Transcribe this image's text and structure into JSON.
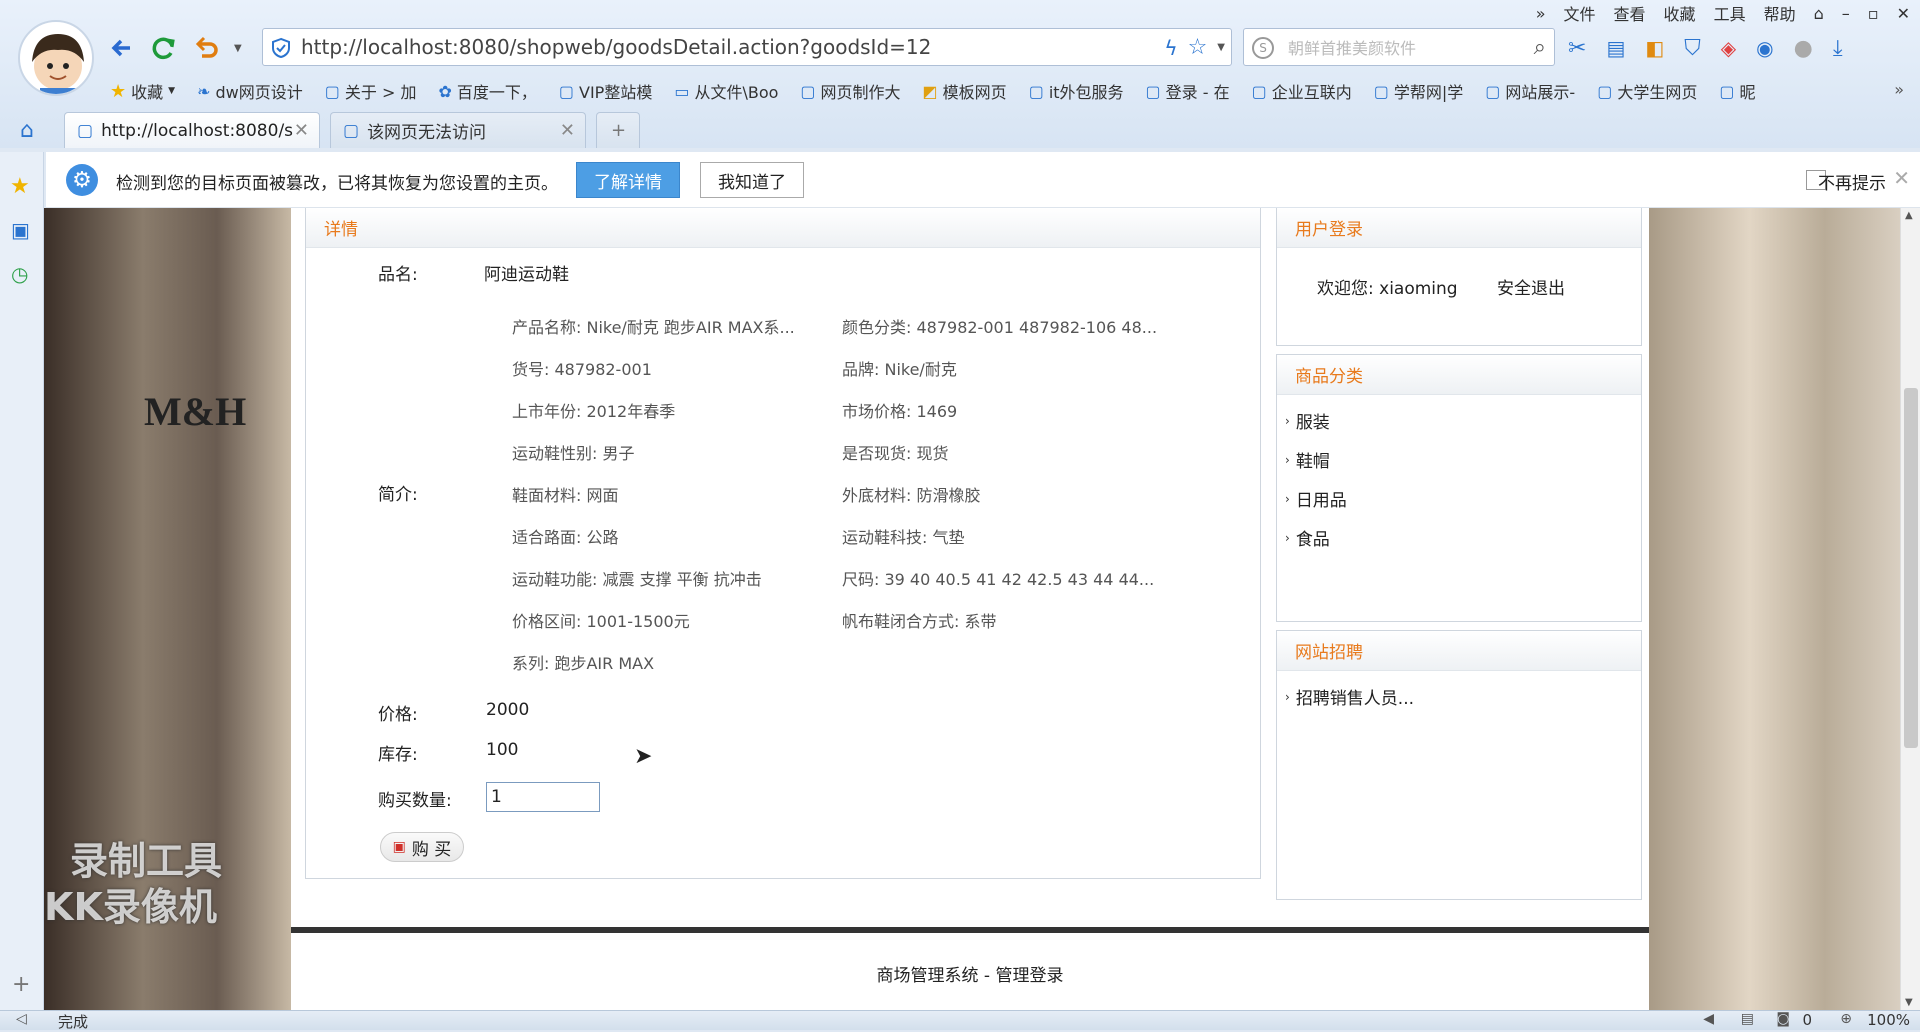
{
  "menubar": [
    "文件",
    "查看",
    "收藏",
    "工具",
    "帮助"
  ],
  "address": {
    "url": "http://localhost:8080/shopweb/goodsDetail.action?goodsId=12"
  },
  "search": {
    "placeholder": "朝鲜首推美颜软件"
  },
  "favorites": {
    "label": "收藏",
    "items": [
      "dw网页设计",
      "关于 > 加",
      "百度一下，",
      "VIP整站模",
      "从文件\\Boo",
      "网页制作大",
      "模板网页",
      "it外包服务",
      "登录 - 在",
      "企业互联内",
      "学帮网|学",
      "网站展示-",
      "大学生网页",
      "昵"
    ]
  },
  "tabs": [
    {
      "title": "http://localhost:8080/s"
    },
    {
      "title": "该网页无法访问"
    }
  ],
  "notice": {
    "message": "检测到您的目标页面被篡改，已将其恢复为您设置的主页。",
    "learn_more": "了解详情",
    "got_it": "我知道了",
    "dont_show": "不再提示"
  },
  "detail": {
    "header": "详情",
    "name_label": "品名:",
    "name_value": "阿迪运动鞋",
    "intro_label": "简介:",
    "specs_left": [
      "产品名称: Nike/耐克 跑步AIR MAX系...",
      "货号: 487982-001",
      "上市年份: 2012年春季",
      "运动鞋性别: 男子",
      "鞋面材料: 网面",
      "适合路面: 公路",
      "运动鞋功能: 减震 支撑 平衡 抗冲击",
      "价格区间: 1001-1500元",
      "系列: 跑步AIR MAX"
    ],
    "specs_right": [
      "颜色分类: 487982-001 487982-106 48...",
      "品牌: Nike/耐克",
      "市场价格: 1469",
      "是否现货: 现货",
      "外底材料: 防滑橡胶",
      "运动鞋科技: 气垫",
      "尺码: 39 40 40.5 41 42 42.5 43 44 44...",
      "帆布鞋闭合方式: 系带"
    ],
    "price_label": "价格:",
    "price_value": "2000",
    "stock_label": "库存:",
    "stock_value": "100",
    "qty_label": "购买数量:",
    "qty_value": "1",
    "buy_label": "购 买"
  },
  "login": {
    "header": "用户登录",
    "welcome": "欢迎您: xiaoming",
    "logout": "安全退出"
  },
  "categories": {
    "header": "商品分类",
    "items": [
      "服装",
      "鞋帽",
      "日用品",
      "食品"
    ]
  },
  "jobs": {
    "header": "网站招聘",
    "items": [
      "招聘销售人员..."
    ]
  },
  "background": {
    "store_sign": "M&H",
    "watermark_line1": "录制工具",
    "watermark_line2": "KK录像机"
  },
  "footer": {
    "text": "商场管理系统 - 管理登录"
  },
  "status": {
    "text": "完成",
    "zoom": "100%",
    "count": "0"
  }
}
